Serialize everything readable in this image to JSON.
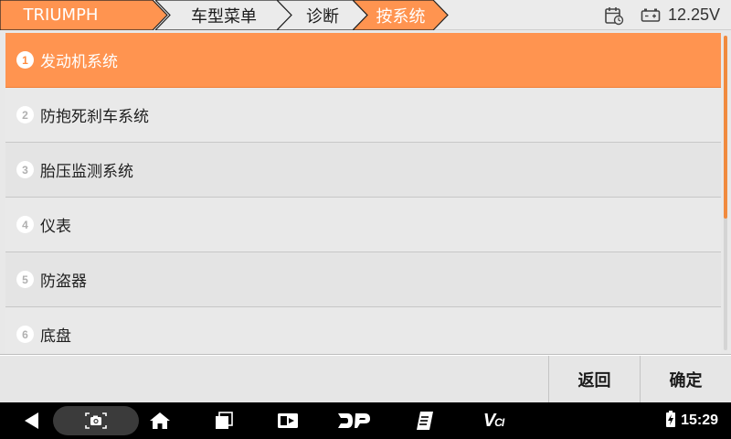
{
  "breadcrumb": {
    "items": [
      {
        "label": "TRIUMPH"
      },
      {
        "label": "车型菜单"
      },
      {
        "label": "诊断"
      },
      {
        "label": "按系统"
      }
    ]
  },
  "status": {
    "voltage": "12.25V"
  },
  "list": {
    "selected_index": 0,
    "items": [
      {
        "num": "1",
        "label": "发动机系统"
      },
      {
        "num": "2",
        "label": "防抱死刹车系统"
      },
      {
        "num": "3",
        "label": "胎压监测系统"
      },
      {
        "num": "4",
        "label": "仪表"
      },
      {
        "num": "5",
        "label": "防盗器"
      },
      {
        "num": "6",
        "label": "底盘"
      }
    ]
  },
  "actions": {
    "back_label": "返回",
    "confirm_label": "确定"
  },
  "navbar": {
    "vci_label": "V",
    "vci_sub": "CI",
    "clock": "15:29"
  },
  "colors": {
    "accent": "#ff9450",
    "selected_row": "#ff9450"
  },
  "icons": [
    "calendar-clock-icon",
    "battery-icon",
    "back-icon",
    "screenshot-icon",
    "home-icon",
    "recent-apps-icon",
    "video-icon",
    "dp-icon",
    "clipboard-icon",
    "vci-icon",
    "wifi-icon",
    "battery-charging-icon"
  ]
}
